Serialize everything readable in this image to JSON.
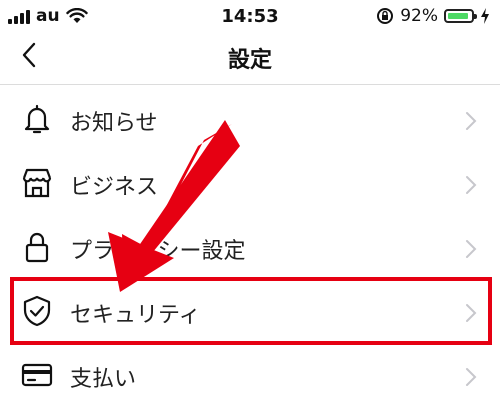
{
  "status_bar": {
    "carrier": "au",
    "time": "14:53",
    "battery_percent": "92%",
    "icons": [
      "signal-icon",
      "wifi-icon",
      "rotation-lock-icon",
      "battery-icon",
      "charging-icon"
    ]
  },
  "nav": {
    "title": "設定",
    "back_icon": "chevron-left-icon"
  },
  "settings": {
    "items": [
      {
        "label": "お知らせ",
        "icon": "bell-icon"
      },
      {
        "label": "ビジネス",
        "icon": "shop-icon"
      },
      {
        "label": "プライバシー設定",
        "icon": "lock-icon"
      },
      {
        "label": "セキュリティ",
        "icon": "shield-check-icon"
      },
      {
        "label": "支払い",
        "icon": "credit-card-icon"
      }
    ]
  },
  "annotation": {
    "highlight_color": "#e60012",
    "highlighted_item": "セキュリティ"
  }
}
